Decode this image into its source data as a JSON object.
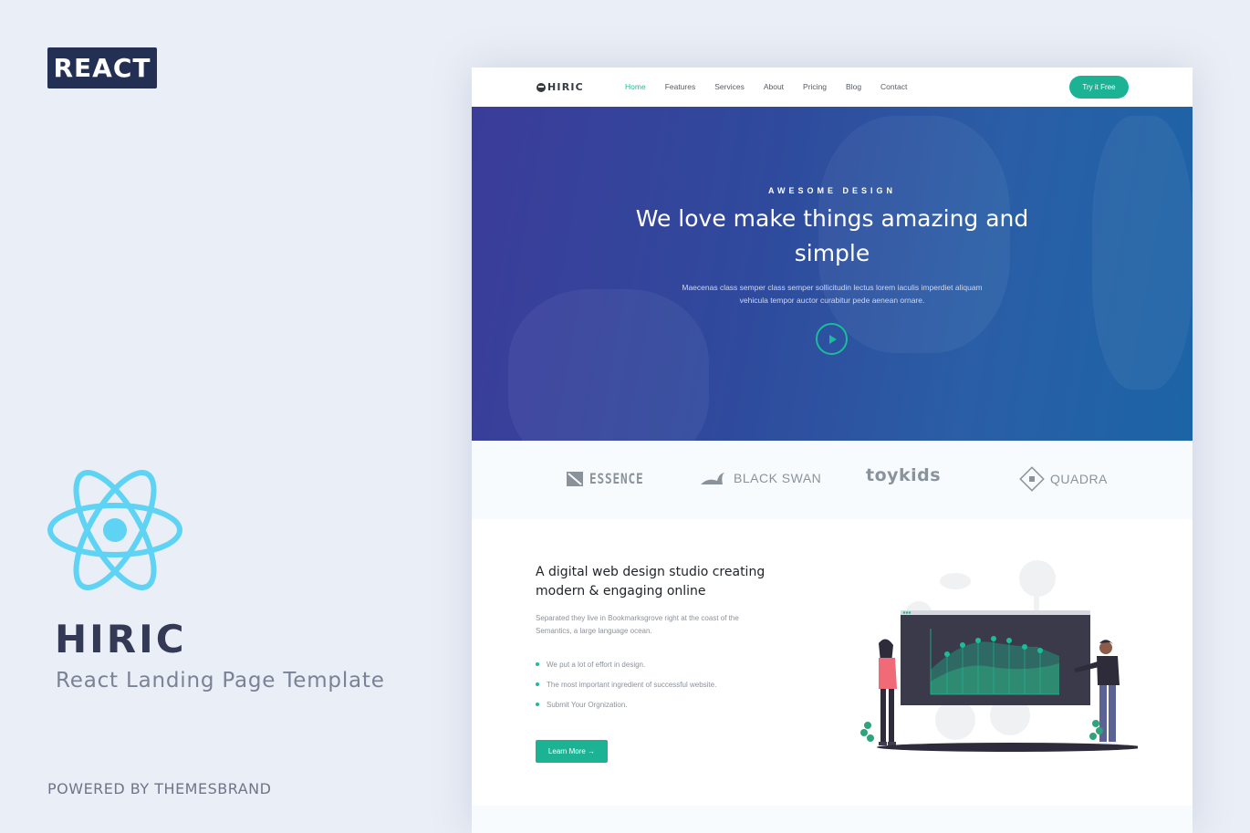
{
  "promo": {
    "badge": "REACT",
    "brand_name": "HIRIC",
    "subtitle": "React Landing Page Template",
    "powered_by": "POWERED BY THEMESBRAND",
    "react_color": "#5ed3f3"
  },
  "site": {
    "logo_text": "HIRIC",
    "nav": [
      {
        "label": "Home",
        "active": true
      },
      {
        "label": "Features",
        "active": false
      },
      {
        "label": "Services",
        "active": false
      },
      {
        "label": "About",
        "active": false
      },
      {
        "label": "Pricing",
        "active": false
      },
      {
        "label": "Blog",
        "active": false
      },
      {
        "label": "Contact",
        "active": false
      }
    ],
    "cta_label": "Try it Free",
    "accent_color": "#1bb394",
    "hero": {
      "tagline": "AWESOME DESIGN",
      "title": "We love make things amazing and simple",
      "description": "Maecenas class semper class semper sollicitudin lectus lorem iaculis imperdiet aliquam vehicula tempor auctor curabitur pede aenean ornare.",
      "play_icon": "play-icon"
    },
    "clients": [
      "ESSENCE",
      "BLACK SWAN",
      "toykids",
      "QUADRA"
    ],
    "feature": {
      "title": "A digital web design studio creating modern & engaging online",
      "description": "Separated they live in Bookmarksgrove right at the coast of the Semantics, a large language ocean.",
      "bullets": [
        "We put a lot of effort in design.",
        "The most important ingredient of successful website.",
        "Submit Your Orgnization."
      ],
      "button_label": "Learn More →"
    }
  }
}
